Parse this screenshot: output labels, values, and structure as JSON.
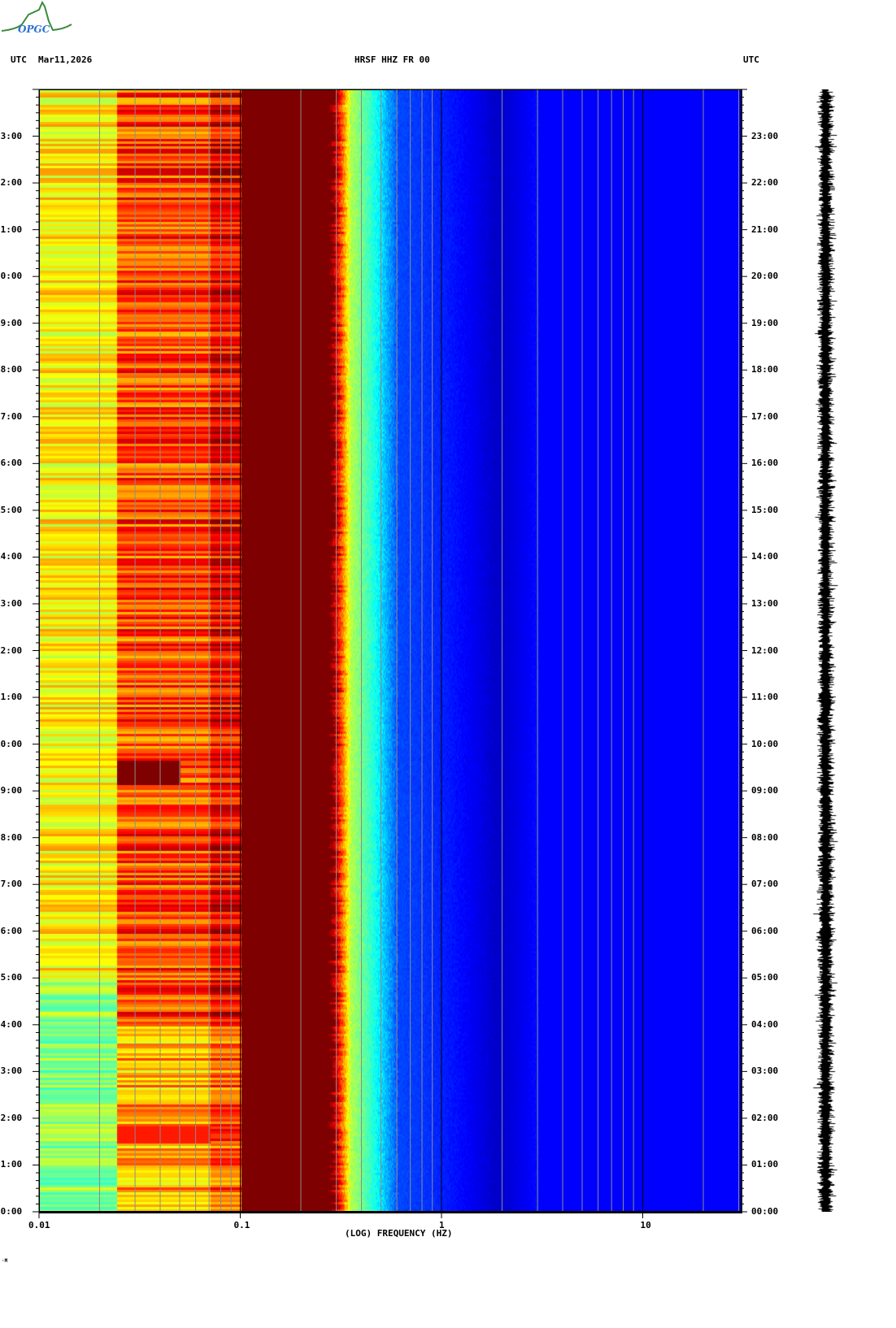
{
  "header": {
    "left_tz": "UTC",
    "date": "Mar11,2026",
    "station": "HRSF HHZ FR 00",
    "right_tz": "UTC"
  },
  "logo": {
    "text": "OPGC"
  },
  "footer_mark": "·M",
  "chart_data": {
    "type": "heatmap",
    "title": "HRSF HHZ FR 00",
    "xlabel": "(LOG) FREQUENCY (HZ)",
    "ylabel": "UTC",
    "x_scale": "log",
    "xlim": [
      0.01,
      30
    ],
    "x_ticks": [
      0.01,
      0.1,
      1,
      10
    ],
    "x_tick_labels": [
      "0.01",
      "0.1",
      "1",
      "10"
    ],
    "ylim_hours": [
      0,
      24
    ],
    "y_tick_labels": [
      "00:00",
      "01:00",
      "02:00",
      "03:00",
      "04:00",
      "05:00",
      "06:00",
      "07:00",
      "08:00",
      "09:00",
      "10:00",
      "11:00",
      "12:00",
      "13:00",
      "14:00",
      "15:00",
      "16:00",
      "17:00",
      "18:00",
      "19:00",
      "20:00",
      "21:00",
      "22:00",
      "23:00"
    ],
    "minor_tick_minutes": 10,
    "frequency_bands": [
      {
        "fmin": 0.01,
        "fmax": 0.024,
        "level": "yellow-green / cyan"
      },
      {
        "fmin": 0.024,
        "fmax": 0.1,
        "level": "orange / red"
      },
      {
        "fmin": 0.1,
        "fmax": 0.27,
        "level": "saturated dark red"
      },
      {
        "fmin": 0.27,
        "fmax": 0.35,
        "level": "red to yellow"
      },
      {
        "fmin": 0.35,
        "fmax": 0.6,
        "level": "cyan to blue"
      },
      {
        "fmin": 0.6,
        "fmax": 30,
        "level": "low (blue)"
      }
    ],
    "events": [
      {
        "time": "09:10-09:40",
        "fmin": 0.024,
        "fmax": 0.05,
        "level": "high (dark red)"
      },
      {
        "time": "01:30-01:50",
        "fmin": 0.024,
        "fmax": 0.07,
        "level": "high (red)"
      }
    ],
    "colors": {
      "low": "#0000a0",
      "high": "#880000",
      "grid": "#8c8c8c"
    }
  }
}
